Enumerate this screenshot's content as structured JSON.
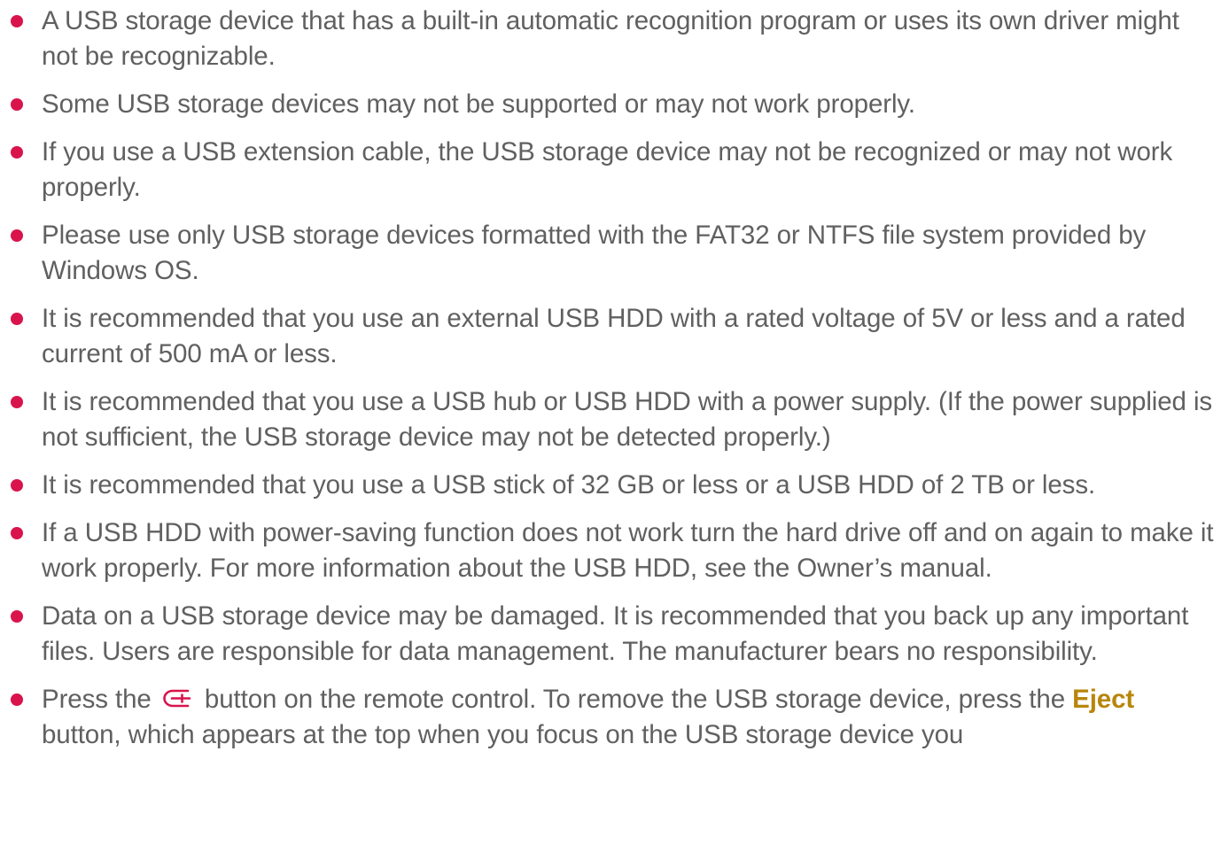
{
  "notes": [
    "A USB storage device that has a built-in automatic recognition program or uses its own driver might not be recognizable.",
    "Some USB storage devices may not be supported or may not work properly.",
    "If you use a USB extension cable, the USB storage device may not be recognized or may not work properly.",
    "Please use only USB storage devices formatted with the FAT32 or NTFS file system provided by Windows OS.",
    "It is recommended that you use an external USB HDD with a rated voltage of 5V or less and a rated current of 500 mA or less.",
    "It is recommended that you use a USB hub or USB HDD with a power supply. (If the power supplied is not sufficient, the USB storage device may not be detected properly.)",
    "It is recommended that you use a USB stick of 32 GB or less or a USB HDD of 2 TB or less.",
    "If a USB HDD with power-saving function does not work turn the hard drive off and on again to make it work properly. For more information about the USB HDD, see the Owner’s manual.",
    "Data on a USB storage device may be damaged. It is recommended that you back up any important files. Users are responsible for data management. The manufacturer bears no responsibility."
  ],
  "last_note": {
    "before_icon": "Press the ",
    "icon": "input-source-icon",
    "after_icon": " button on the remote control. To remove the USB storage device, press the ",
    "eject_label": "Eject",
    "after_eject": " button, which appears at the top when you focus on the USB storage device you"
  },
  "colors": {
    "bullet": "#d9144c",
    "icon": "#d9144c",
    "eject": "#b8860b",
    "text": "#606060"
  }
}
